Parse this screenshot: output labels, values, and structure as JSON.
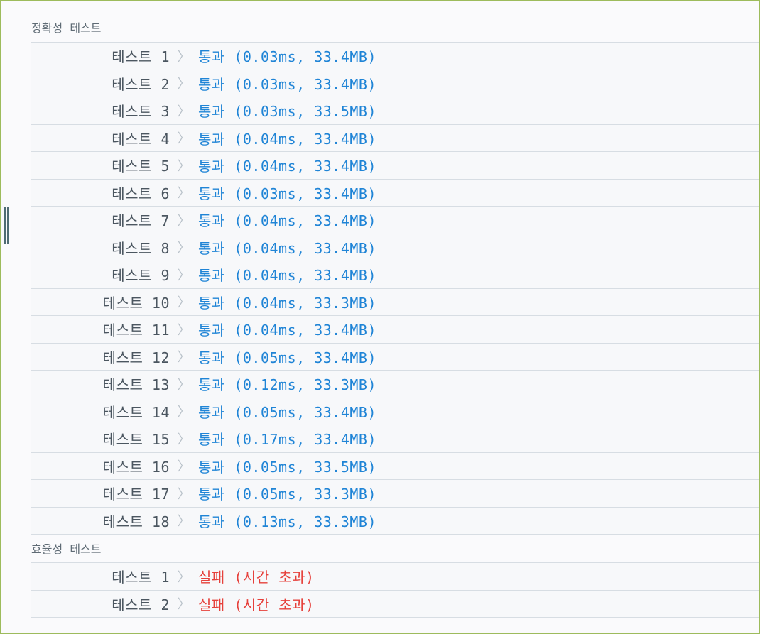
{
  "sections": [
    {
      "title": "정확성  테스트",
      "rows": [
        {
          "name": "테스트 1",
          "result": "통과 (0.03ms, 33.4MB)",
          "status": "pass"
        },
        {
          "name": "테스트 2",
          "result": "통과 (0.03ms, 33.4MB)",
          "status": "pass"
        },
        {
          "name": "테스트 3",
          "result": "통과 (0.03ms, 33.5MB)",
          "status": "pass"
        },
        {
          "name": "테스트 4",
          "result": "통과 (0.04ms, 33.4MB)",
          "status": "pass"
        },
        {
          "name": "테스트 5",
          "result": "통과 (0.04ms, 33.4MB)",
          "status": "pass"
        },
        {
          "name": "테스트 6",
          "result": "통과 (0.03ms, 33.4MB)",
          "status": "pass"
        },
        {
          "name": "테스트 7",
          "result": "통과 (0.04ms, 33.4MB)",
          "status": "pass"
        },
        {
          "name": "테스트 8",
          "result": "통과 (0.04ms, 33.4MB)",
          "status": "pass"
        },
        {
          "name": "테스트 9",
          "result": "통과 (0.04ms, 33.4MB)",
          "status": "pass"
        },
        {
          "name": "테스트 10",
          "result": "통과 (0.04ms, 33.3MB)",
          "status": "pass"
        },
        {
          "name": "테스트 11",
          "result": "통과 (0.04ms, 33.4MB)",
          "status": "pass"
        },
        {
          "name": "테스트 12",
          "result": "통과 (0.05ms, 33.4MB)",
          "status": "pass"
        },
        {
          "name": "테스트 13",
          "result": "통과 (0.12ms, 33.3MB)",
          "status": "pass"
        },
        {
          "name": "테스트 14",
          "result": "통과 (0.05ms, 33.4MB)",
          "status": "pass"
        },
        {
          "name": "테스트 15",
          "result": "통과 (0.17ms, 33.4MB)",
          "status": "pass"
        },
        {
          "name": "테스트 16",
          "result": "통과 (0.05ms, 33.5MB)",
          "status": "pass"
        },
        {
          "name": "테스트 17",
          "result": "통과 (0.05ms, 33.3MB)",
          "status": "pass"
        },
        {
          "name": "테스트 18",
          "result": "통과 (0.13ms, 33.3MB)",
          "status": "pass"
        }
      ]
    },
    {
      "title": "효율성  테스트",
      "rows": [
        {
          "name": "테스트 1",
          "result": "실패 (시간 초과)",
          "status": "fail"
        },
        {
          "name": "테스트 2",
          "result": "실패 (시간 초과)",
          "status": "fail"
        }
      ]
    }
  ],
  "chevron_icon": "chevron-right-icon",
  "chevron_glyph": "〉",
  "colors": {
    "pass": "#1f84d6",
    "fail": "#e6403b",
    "label": "#4b5660",
    "frame_border": "#9dbb5c"
  }
}
